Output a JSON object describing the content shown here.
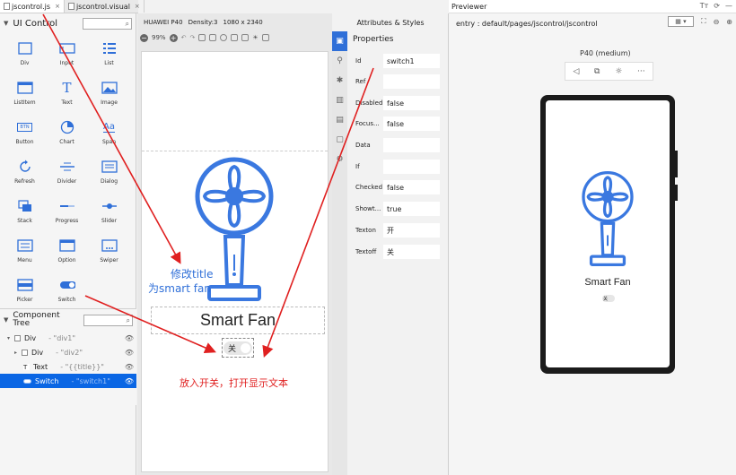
{
  "editor_tabs": [
    {
      "label": "jscontrol.js",
      "close": "×"
    },
    {
      "label": "jscontrol.visual",
      "close": "×"
    }
  ],
  "ui_control": {
    "title": "UI Control",
    "palette": [
      {
        "label": "Div",
        "icon": "div-icon"
      },
      {
        "label": "Input",
        "icon": "input-icon"
      },
      {
        "label": "List",
        "icon": "list-icon"
      },
      {
        "label": "ListItem",
        "icon": "listitem-icon"
      },
      {
        "label": "Text",
        "icon": "text-icon"
      },
      {
        "label": "Image",
        "icon": "image-icon"
      },
      {
        "label": "Button",
        "icon": "button-icon"
      },
      {
        "label": "Chart",
        "icon": "chart-icon"
      },
      {
        "label": "Span",
        "icon": "span-icon"
      },
      {
        "label": "Refresh",
        "icon": "refresh-icon"
      },
      {
        "label": "Divider",
        "icon": "divider-icon"
      },
      {
        "label": "Dialog",
        "icon": "dialog-icon"
      },
      {
        "label": "Stack",
        "icon": "stack-icon"
      },
      {
        "label": "Progress",
        "icon": "progress-icon"
      },
      {
        "label": "Slider",
        "icon": "slider-icon"
      },
      {
        "label": "Menu",
        "icon": "menu-icon"
      },
      {
        "label": "Option",
        "icon": "option-icon"
      },
      {
        "label": "Swiper",
        "icon": "swiper-icon"
      },
      {
        "label": "Picker",
        "icon": "picker-icon"
      },
      {
        "label": "Switch",
        "icon": "switch-icon"
      }
    ],
    "btn_glyph": "BTN",
    "text_glyph": "T",
    "span_glyph": "Aa"
  },
  "component_tree": {
    "title": "Component Tree",
    "rows": [
      {
        "name": "Div",
        "attr": "- \"div1\""
      },
      {
        "name": "Div",
        "attr": "- \"div2\""
      },
      {
        "name": "Text",
        "attr": "- \"{{title}}\""
      },
      {
        "name": "Switch",
        "attr": "- \"switch1\""
      }
    ]
  },
  "canvas": {
    "device": "HUAWEI P40",
    "density": "Density:3",
    "resolution": "1080 x 2340",
    "zoom": "99%",
    "title_text": "Smart Fan",
    "switch_text": "关"
  },
  "attributes": {
    "panel_title": "Attributes & Styles",
    "section": "Properties",
    "props": [
      {
        "label": "Id",
        "value": "switch1"
      },
      {
        "label": "Ref",
        "value": ""
      },
      {
        "label": "Disabled",
        "value": "false"
      },
      {
        "label": "Focus...",
        "value": "false"
      },
      {
        "label": "Data",
        "value": ""
      },
      {
        "label": "If",
        "value": ""
      },
      {
        "label": "Checked",
        "value": "false"
      },
      {
        "label": "Showt...",
        "value": "true"
      },
      {
        "label": "Texton",
        "value": "开"
      },
      {
        "label": "Textoff",
        "value": "关"
      }
    ]
  },
  "previewer": {
    "title": "Previewer",
    "entry": "entry : default/pages/jscontrol/jscontrol",
    "device_label": "P40 (medium)",
    "app_text": "Smart Fan",
    "switch_text": "关"
  },
  "annotations": {
    "title_note_1": "修改title",
    "title_note_2": "为smart fan",
    "switch_note": "放入开关，打开显示文本"
  },
  "colors": {
    "accent": "#2f6fd8",
    "selection": "#0a66e4",
    "annotation_red": "#e02020",
    "fan_blue": "#3a78e0"
  }
}
